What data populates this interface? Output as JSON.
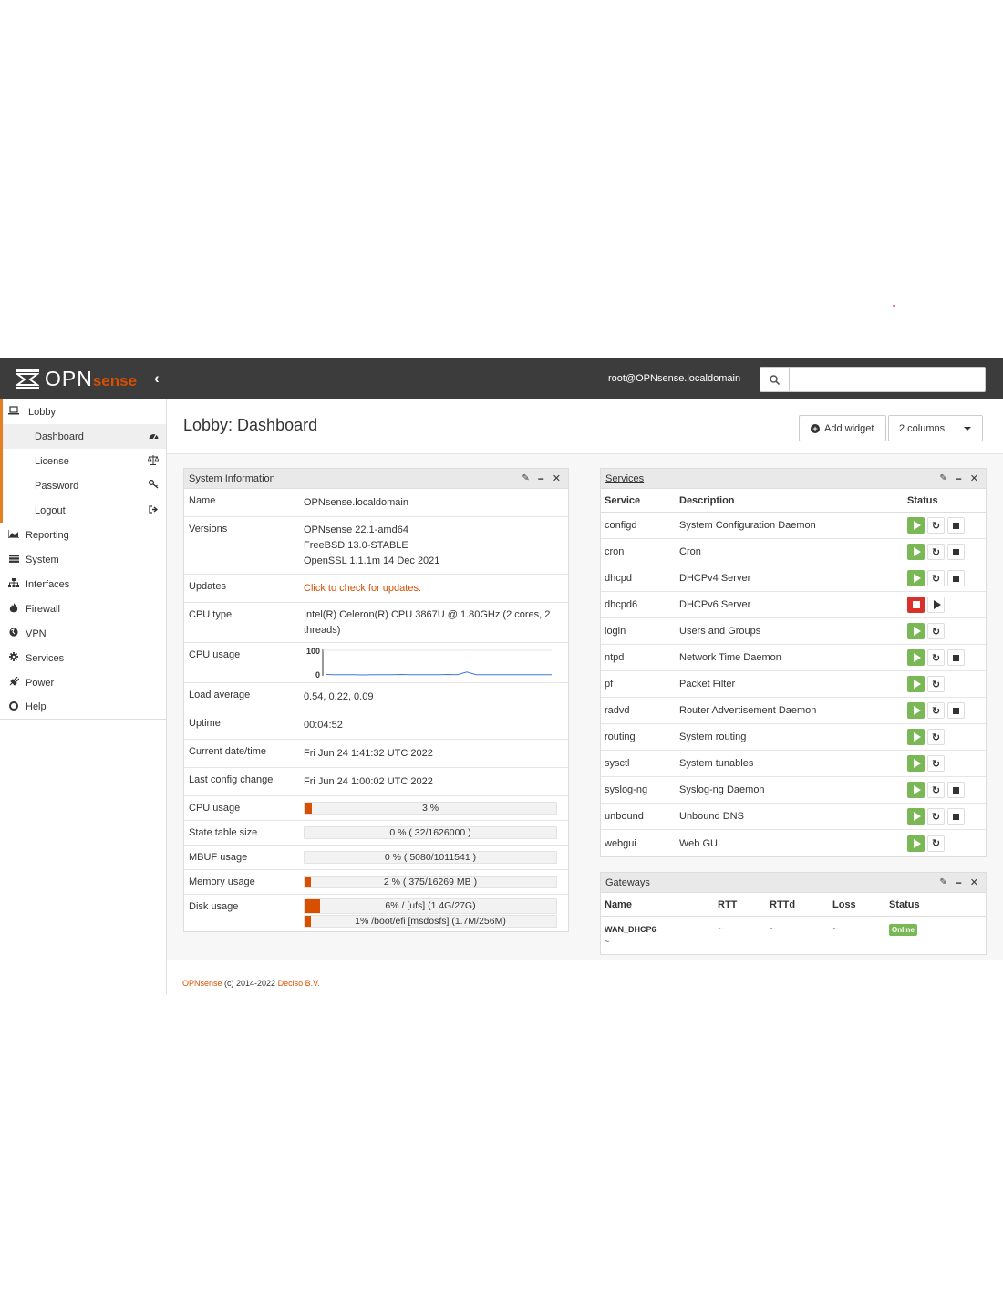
{
  "header": {
    "logo_main": "OPN",
    "logo_accent": "sense",
    "user": "root@OPNsense.localdomain",
    "search_placeholder": ""
  },
  "sidebar": {
    "lobby": "Lobby",
    "lobby_items": [
      {
        "label": "Dashboard",
        "icon": "dashboard-icon"
      },
      {
        "label": "License",
        "icon": "balance-scale-icon"
      },
      {
        "label": "Password",
        "icon": "key-icon"
      },
      {
        "label": "Logout",
        "icon": "sign-out-icon"
      }
    ],
    "items": [
      {
        "label": "Reporting",
        "icon": "area-chart-icon"
      },
      {
        "label": "System",
        "icon": "server-icon"
      },
      {
        "label": "Interfaces",
        "icon": "sitemap-icon"
      },
      {
        "label": "Firewall",
        "icon": "fire-icon"
      },
      {
        "label": "VPN",
        "icon": "globe-icon"
      },
      {
        "label": "Services",
        "icon": "cog-icon"
      },
      {
        "label": "Power",
        "icon": "plug-icon"
      },
      {
        "label": "Help",
        "icon": "life-ring-icon"
      }
    ]
  },
  "page": {
    "title": "Lobby: Dashboard",
    "add_widget": "Add widget",
    "columns": "2 columns"
  },
  "sysinfo": {
    "title": "System Information",
    "name_k": "Name",
    "name_v": "OPNsense.localdomain",
    "versions_k": "Versions",
    "versions_v1": "OPNsense 22.1-amd64",
    "versions_v2": "FreeBSD 13.0-STABLE",
    "versions_v3": "OpenSSL 1.1.1m 14 Dec 2021",
    "updates_k": "Updates",
    "updates_v": "Click to check for updates.",
    "cputype_k": "CPU type",
    "cputype_v": "Intel(R) Celeron(R) CPU 3867U @ 1.80GHz (2 cores, 2 threads)",
    "cpugraph_k": "CPU usage",
    "cpugraph_max": "100",
    "cpugraph_min": "0",
    "load_k": "Load average",
    "load_v": "0.54, 0.22, 0.09",
    "uptime_k": "Uptime",
    "uptime_v": "00:04:52",
    "date_k": "Current date/time",
    "date_v": "Fri Jun 24 1:41:32 UTC 2022",
    "cfg_k": "Last config change",
    "cfg_v": "Fri Jun 24 1:00:02 UTC 2022",
    "cpu_k": "CPU usage",
    "cpu_v": "3 %",
    "cpu_pct": 3,
    "state_k": "State table size",
    "state_v": "0 % ( 32/1626000 )",
    "state_pct": 0,
    "mbuf_k": "MBUF usage",
    "mbuf_v": "0 % ( 5080/1011541 )",
    "mbuf_pct": 0,
    "mem_k": "Memory usage",
    "mem_v": "2 % ( 375/16269 MB )",
    "mem_pct": 2,
    "disk_k": "Disk usage",
    "disk_v1": "6% / [ufs] (1.4G/27G)",
    "disk_pct1": 6,
    "disk_v2": "1% /boot/efi [msdosfs] (1.7M/256M)",
    "disk_pct2": 1,
    "cpu_series": [
      2,
      1,
      1,
      1,
      0,
      1,
      1,
      1,
      2,
      1,
      1,
      1,
      1,
      2,
      1,
      12,
      1,
      1,
      1,
      1,
      1,
      1,
      1,
      1,
      1
    ]
  },
  "services": {
    "title": "Services",
    "h_service": "Service",
    "h_desc": "Description",
    "h_status": "Status",
    "rows": [
      {
        "name": "configd",
        "desc": "System Configuration Daemon",
        "state": "running",
        "stop": true
      },
      {
        "name": "cron",
        "desc": "Cron",
        "state": "running",
        "stop": true
      },
      {
        "name": "dhcpd",
        "desc": "DHCPv4 Server",
        "state": "running",
        "stop": true
      },
      {
        "name": "dhcpd6",
        "desc": "DHCPv6 Server",
        "state": "stopped",
        "stop": false
      },
      {
        "name": "login",
        "desc": "Users and Groups",
        "state": "running",
        "stop": false
      },
      {
        "name": "ntpd",
        "desc": "Network Time Daemon",
        "state": "running",
        "stop": true
      },
      {
        "name": "pf",
        "desc": "Packet Filter",
        "state": "running",
        "stop": false
      },
      {
        "name": "radvd",
        "desc": "Router Advertisement Daemon",
        "state": "running",
        "stop": true
      },
      {
        "name": "routing",
        "desc": "System routing",
        "state": "running",
        "stop": false
      },
      {
        "name": "sysctl",
        "desc": "System tunables",
        "state": "running",
        "stop": false
      },
      {
        "name": "syslog-ng",
        "desc": "Syslog-ng Daemon",
        "state": "running",
        "stop": true
      },
      {
        "name": "unbound",
        "desc": "Unbound DNS",
        "state": "running",
        "stop": true
      },
      {
        "name": "webgui",
        "desc": "Web GUI",
        "state": "running",
        "stop": false
      }
    ]
  },
  "gateways": {
    "title": "Gateways",
    "h_name": "Name",
    "h_rtt": "RTT",
    "h_rttd": "RTTd",
    "h_loss": "Loss",
    "h_status": "Status",
    "row": {
      "name": "WAN_DHCP6",
      "sub": "~",
      "rtt": "~",
      "rttd": "~",
      "loss": "~",
      "status": "Online"
    }
  },
  "footer": {
    "brand": "OPNsense",
    "text": " (c) 2014-2022 ",
    "company": "Deciso B.V."
  },
  "colors": {
    "accent": "#d94f00",
    "ok": "#79b855",
    "bad": "#d9302c"
  }
}
